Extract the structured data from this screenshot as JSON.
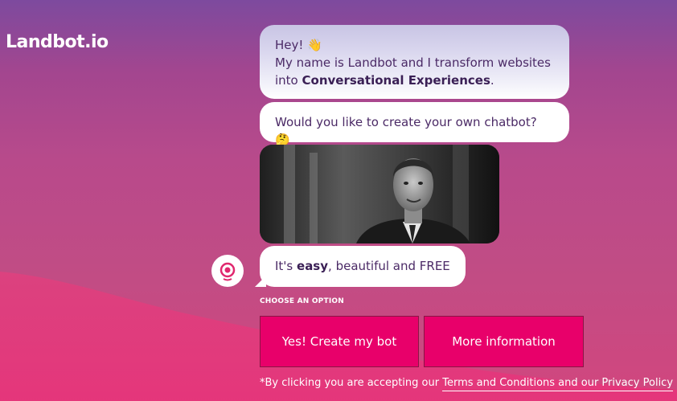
{
  "logo": {
    "text": "Landbot.io"
  },
  "chat": {
    "msg1": {
      "line1": "Hey! 👋",
      "line2": "My name is Landbot and I transform websites",
      "line3_prefix": "into ",
      "line3_bold": "Conversational Experiences",
      "line3_suffix": "."
    },
    "msg2": {
      "text": "Would you like to create your own chatbot? 🤔"
    },
    "gif": {
      "icon": "animated-gif-image"
    },
    "msg3": {
      "prefix": "It's ",
      "bold": "easy",
      "suffix": ", beautiful and FREE"
    },
    "avatar": {
      "icon": "landbot-avatar-icon"
    }
  },
  "options": {
    "heading": "CHOOSE AN OPTION",
    "buttons": [
      {
        "label": "Yes! Create my bot"
      },
      {
        "label": "More information"
      }
    ]
  },
  "disclaimer": {
    "prefix": "*By clicking you are accepting our ",
    "link": "Terms and Conditions and our Privacy Policy"
  },
  "colors": {
    "button_bg": "#e8006a",
    "bubble_text": "#4b2a66",
    "background_top": "#7d4a9e",
    "background_bottom": "#d2467e"
  }
}
